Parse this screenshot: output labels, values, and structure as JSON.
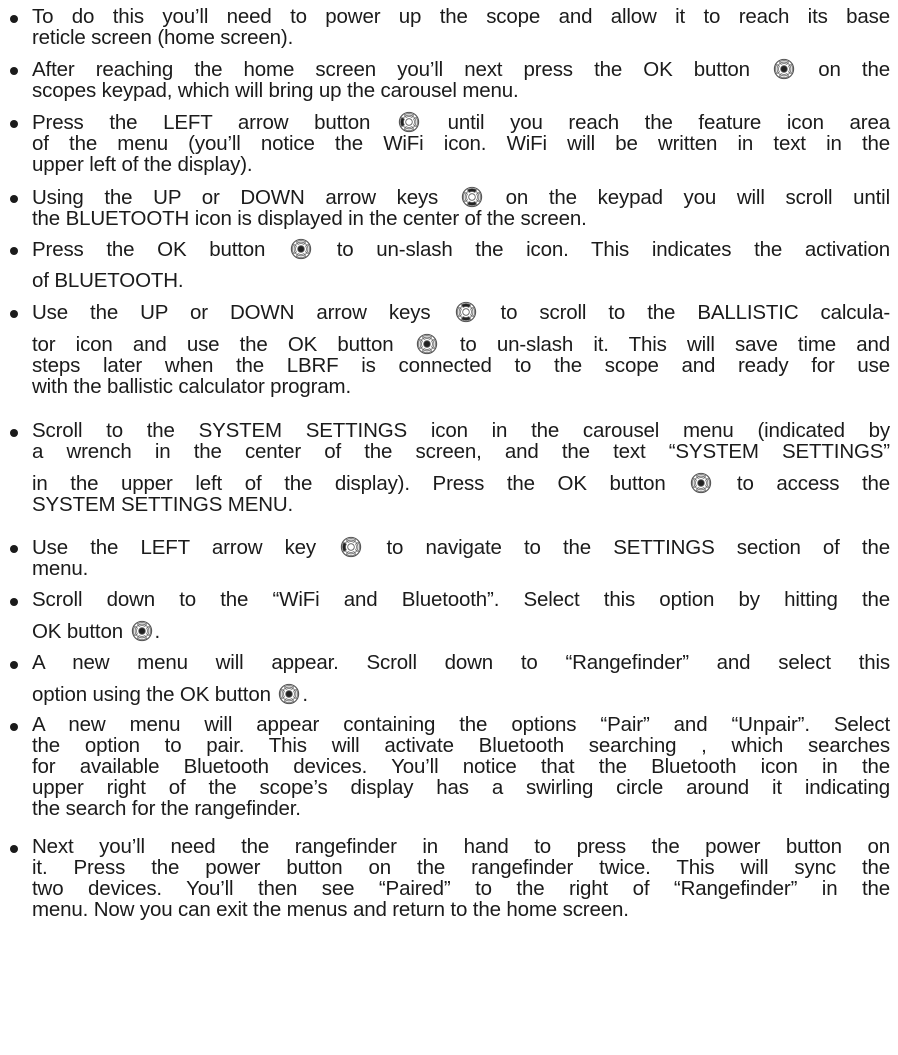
{
  "items": [
    [
      "To do this you’ll need to power up the scope and allow it to reach its base",
      "reticle screen (home screen)."
    ],
    [
      "After reaching the home screen you’ll next press the OK button ",
      "|ok|",
      " on the",
      "scopes keypad, which will bring up the carousel menu."
    ],
    [
      "Press the LEFT arrow button ",
      "|left|",
      " until you reach the feature icon area",
      "of the menu (you’ll notice the WiFi icon. WiFi will be written in text in the",
      "upper left of the display)."
    ],
    [
      "Using the UP or DOWN arrow keys ",
      "|updown|",
      " on the keypad you will scroll until",
      "the BLUETOOTH icon is displayed in the center of the screen."
    ],
    [
      "Press the OK button ",
      "|ok|",
      " to un-slash the icon. This indicates the activation",
      "of BLUETOOTH."
    ],
    [
      "Use the UP or DOWN arrow keys ",
      "|updown|",
      " to scroll to the BALLISTIC calcula-",
      "tor icon and use the OK button ",
      "|ok|",
      " to un-slash it. This will save time and",
      "steps later when the LBRF is connected to the scope and ready for use",
      "with the ballistic calculator program."
    ],
    [
      "Scroll to the SYSTEM SETTINGS icon in the carousel menu (indicated by",
      "a wrench in the center of the screen, and the text “SYSTEM SETTINGS”",
      "in the upper left of the display). Press the OK button ",
      "|ok|",
      " to access the",
      "SYSTEM SETTINGS MENU."
    ],
    [
      "Use the LEFT arrow key ",
      "|left|",
      " to navigate to the SETTINGS section of the",
      "menu."
    ],
    [
      "Scroll down to the “WiFi and Bluetooth”. Select this option by hitting the",
      "OK button ",
      "|ok|",
      "."
    ],
    [
      "A new menu will appear. Scroll down to “Rangefinder” and select this",
      "option using the OK button ",
      "|ok|",
      "."
    ],
    [
      "A new menu will appear containing the options “Pair” and “Unpair”. Select",
      "the option to pair. This will activate Bluetooth searching , which searches",
      "for available Bluetooth devices. You’ll notice that the Bluetooth icon in the",
      "upper right of the scope’s display has a swirling circle around it indicating",
      "the search for the rangefinder."
    ],
    [
      "Next you’ll need the rangefinder in hand to press the power button on",
      "it. Press the power button on the rangefinder twice. This will sync the",
      "two devices. You’ll then see “Paired” to the right of “Rangefinder” in the",
      "menu. Now you can exit the menus and return to the home screen."
    ]
  ]
}
